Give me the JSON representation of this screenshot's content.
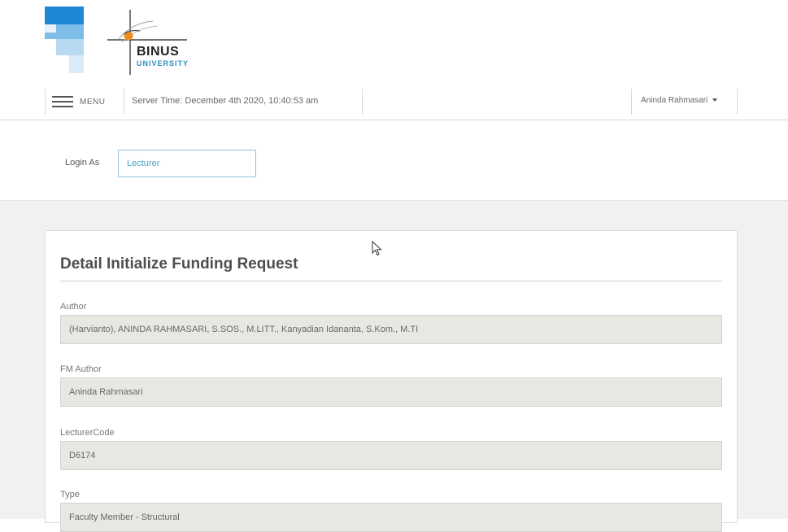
{
  "header": {
    "brand_name": "BINUS",
    "brand_subtitle": "UNIVERSITY"
  },
  "nav": {
    "menu_label": "MENU",
    "server_time": "Server Time: December 4th 2020, 10:40:53 am",
    "user_name": "Aninda Rahmasari"
  },
  "login": {
    "label": "Login As",
    "value": "Lecturer"
  },
  "card": {
    "title": "Detail Initialize Funding Request",
    "fields": [
      {
        "label": "Author",
        "value": "(Harvianto), ANINDA RAHMASARI, S.SOS., M.LITT., Kanyadian Idananta, S.Kom., M.TI"
      },
      {
        "label": "FM Author",
        "value": "Aninda Rahmasari"
      },
      {
        "label": "LecturerCode",
        "value": "D6174"
      },
      {
        "label": "Type",
        "value": "Faculty Member - Structural"
      }
    ]
  },
  "colors": {
    "brand_blue": "#1e88d6",
    "accent_cyan": "#2a8fc2",
    "readonly_bg": "#e8e8e3",
    "page_bg": "#f1f1f1"
  },
  "icons": [
    "hamburger-icon",
    "caret-down-icon",
    "mouse-cursor-icon"
  ]
}
